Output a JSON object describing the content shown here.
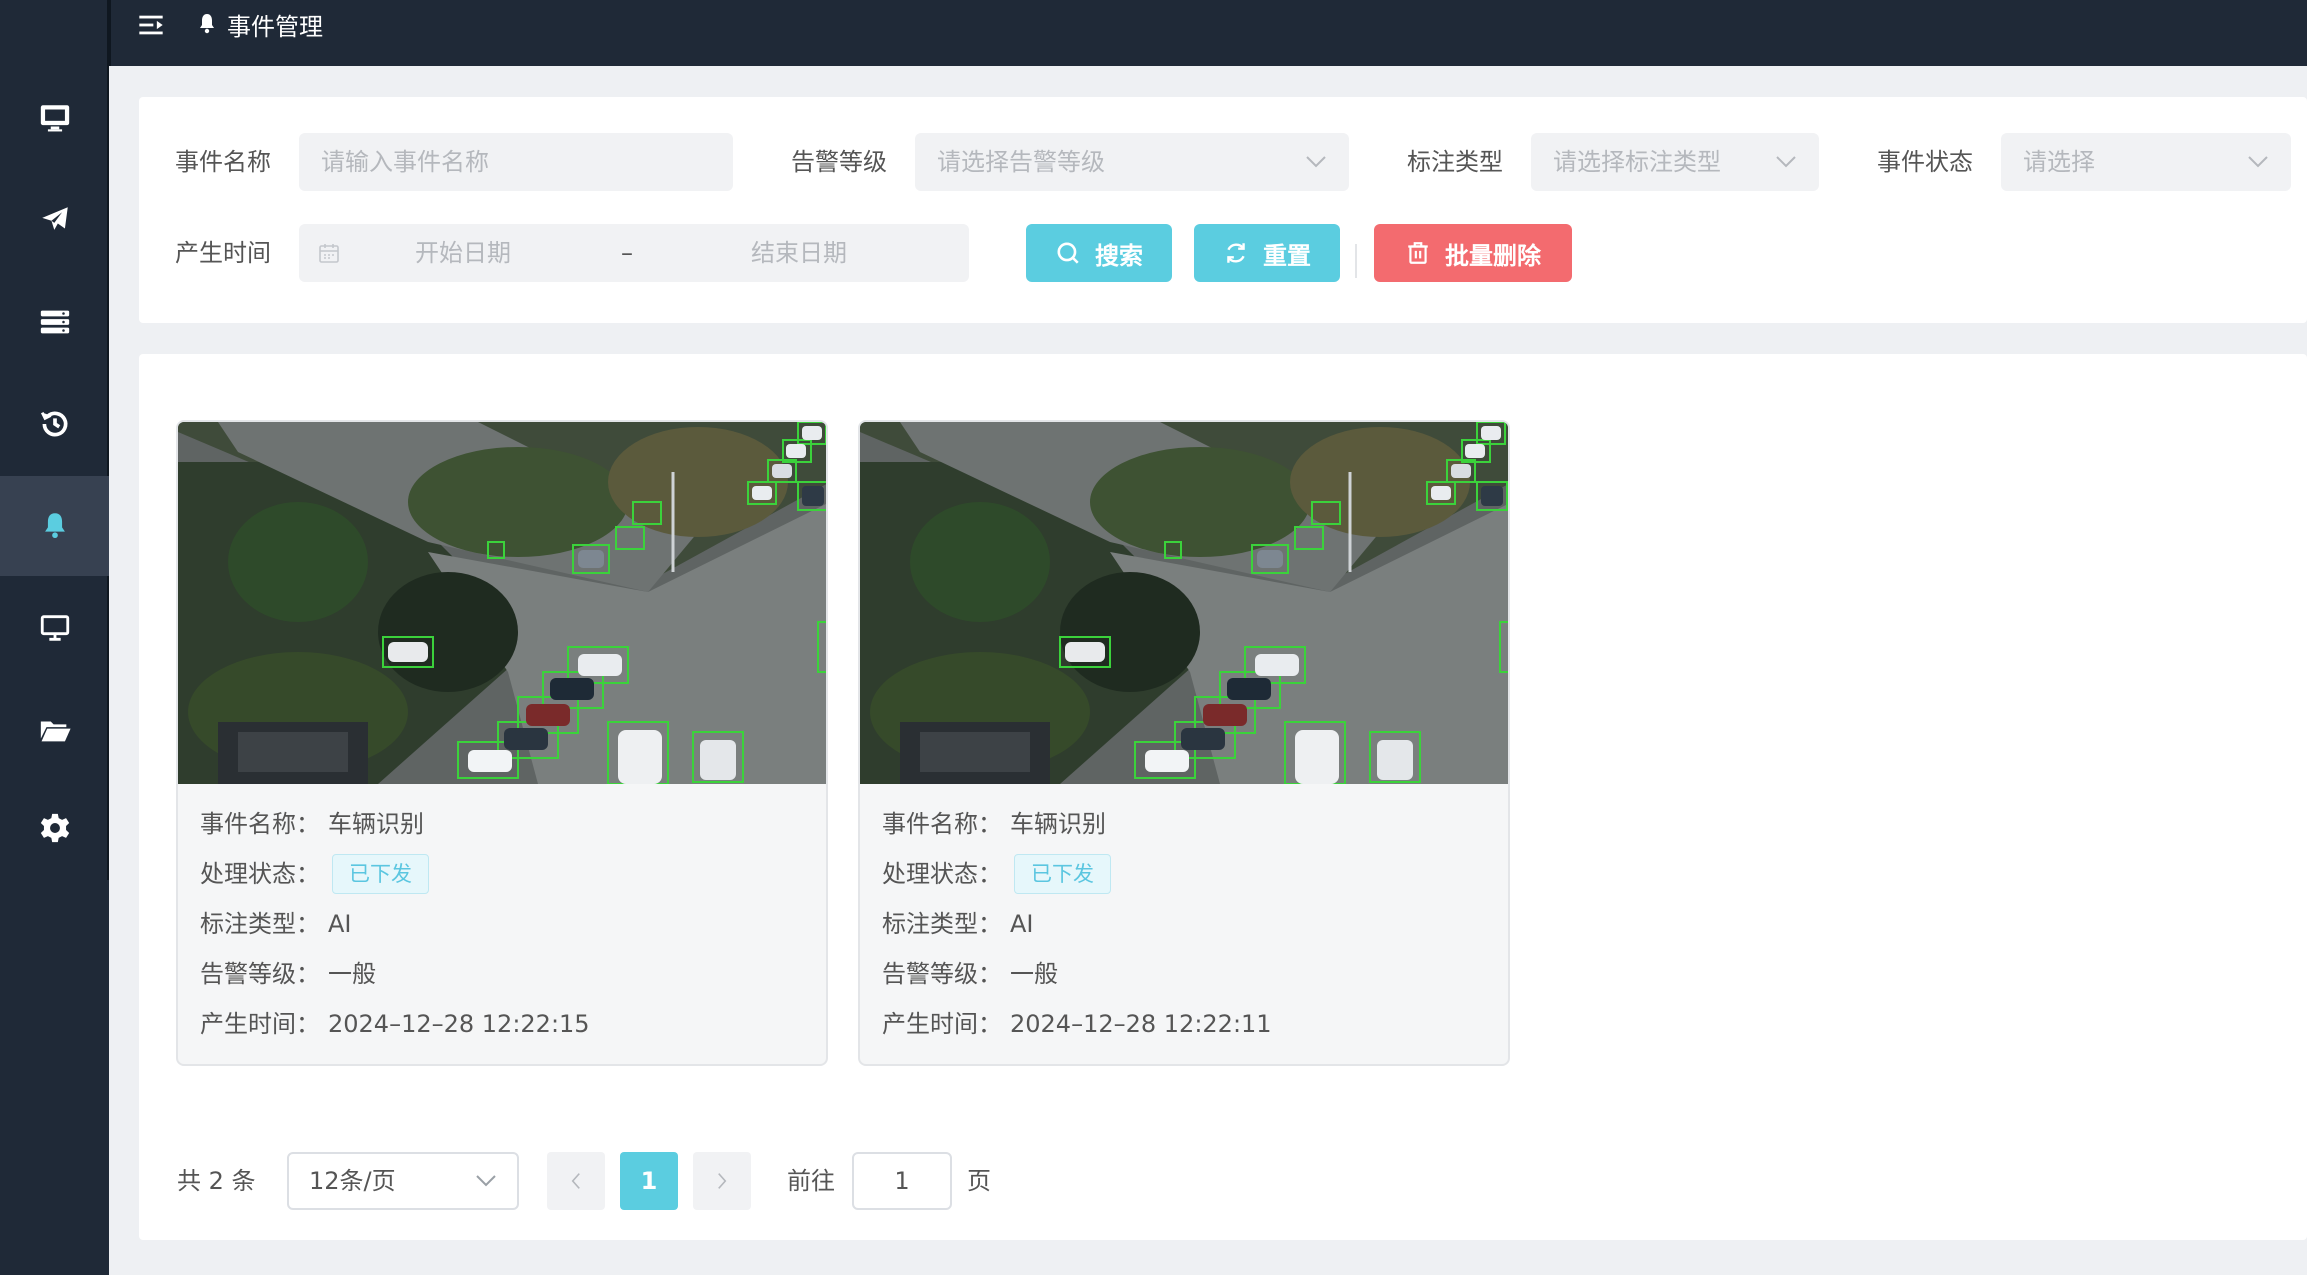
{
  "header": {
    "title": "事件管理"
  },
  "filters": {
    "event_name_label": "事件名称",
    "event_name_placeholder": "请输入事件名称",
    "alarm_level_label": "告警等级",
    "alarm_level_placeholder": "请选择告警等级",
    "mark_type_label": "标注类型",
    "mark_type_placeholder": "请选择标注类型",
    "event_status_label": "事件状态",
    "event_status_placeholder": "请选择",
    "time_label": "产生时间",
    "start_placeholder": "开始日期",
    "range_sep": "–",
    "end_placeholder": "结束日期",
    "search_label": "搜索",
    "reset_label": "重置",
    "batch_delete_label": "批量删除"
  },
  "cards": [
    {
      "name_key": "事件名称：",
      "name_value": "车辆识别",
      "status_key": "处理状态：",
      "status_value": "已下发",
      "type_key": "标注类型：",
      "type_value": "AI",
      "level_key": "告警等级：",
      "level_value": "一般",
      "time_key": "产生时间：",
      "time_value": "2024–12–28 12:22:15"
    },
    {
      "name_key": "事件名称：",
      "name_value": "车辆识别",
      "status_key": "处理状态：",
      "status_value": "已下发",
      "type_key": "标注类型：",
      "type_value": "AI",
      "level_key": "告警等级：",
      "level_value": "一般",
      "time_key": "产生时间：",
      "time_value": "2024–12–28 12:22:11"
    }
  ],
  "pagination": {
    "total_text": "共 2 条",
    "page_size": "12条/页",
    "current_page": "1",
    "goto_label": "前往",
    "goto_value": "1",
    "unit_label": "页"
  },
  "sidebar": {
    "items": [
      {
        "icon": "monitor-icon"
      },
      {
        "icon": "plane-icon"
      },
      {
        "icon": "server-icon"
      },
      {
        "icon": "history-icon"
      },
      {
        "icon": "bell-icon",
        "active": true
      },
      {
        "icon": "screen-icon"
      },
      {
        "icon": "folder-open-icon"
      },
      {
        "icon": "gear-icon"
      }
    ]
  },
  "colors": {
    "accent": "#5bcde0",
    "danger": "#f36b6f",
    "sidebar": "#1f2937"
  }
}
